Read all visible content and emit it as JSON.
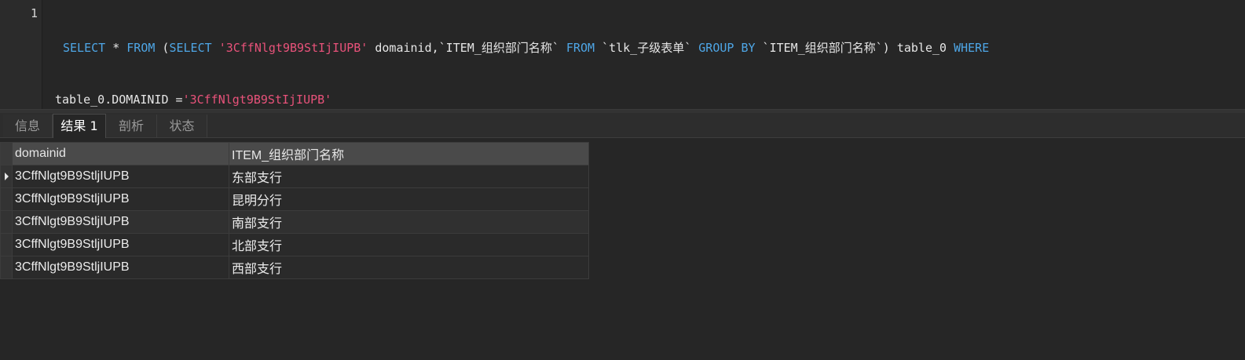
{
  "editor": {
    "line_number": "1",
    "tokens_line1": [
      {
        "t": "SELECT",
        "c": "kw"
      },
      {
        "t": " * ",
        "c": "plain"
      },
      {
        "t": "FROM",
        "c": "kw"
      },
      {
        "t": " (",
        "c": "plain"
      },
      {
        "t": "SELECT",
        "c": "kw"
      },
      {
        "t": " ",
        "c": "plain"
      },
      {
        "t": "'3CffNlgt9B9StIjIUPB'",
        "c": "str"
      },
      {
        "t": " domainid,`ITEM_组织部门名称` ",
        "c": "plain"
      },
      {
        "t": "FROM",
        "c": "kw"
      },
      {
        "t": " `tlk_子级表单` ",
        "c": "plain"
      },
      {
        "t": "GROUP BY",
        "c": "kw"
      },
      {
        "t": " `ITEM_组织部门名称`) table_0 ",
        "c": "plain"
      },
      {
        "t": "WHERE",
        "c": "kw"
      }
    ],
    "tokens_line2": [
      {
        "t": "table_0.DOMAINID =",
        "c": "plain"
      },
      {
        "t": "'3CffNlgt9B9StIjIUPB'",
        "c": "str"
      }
    ]
  },
  "tabs": [
    {
      "label": "信息",
      "active": false
    },
    {
      "label": "结果 1",
      "active": true
    },
    {
      "label": "剖析",
      "active": false
    },
    {
      "label": "状态",
      "active": false
    }
  ],
  "grid": {
    "columns": [
      "domainid",
      "ITEM_组织部门名称"
    ],
    "rows": [
      [
        "3CffNlgt9B9StljIUPB",
        "东部支行"
      ],
      [
        "3CffNlgt9B9StljIUPB",
        "昆明分行"
      ],
      [
        "3CffNlgt9B9StljIUPB",
        "南部支行"
      ],
      [
        "3CffNlgt9B9StljIUPB",
        "北部支行"
      ],
      [
        "3CffNlgt9B9StljIUPB",
        "西部支行"
      ]
    ]
  },
  "colors": {
    "keyword": "#4ea6e6",
    "string": "#e8527a",
    "background": "#262626"
  }
}
